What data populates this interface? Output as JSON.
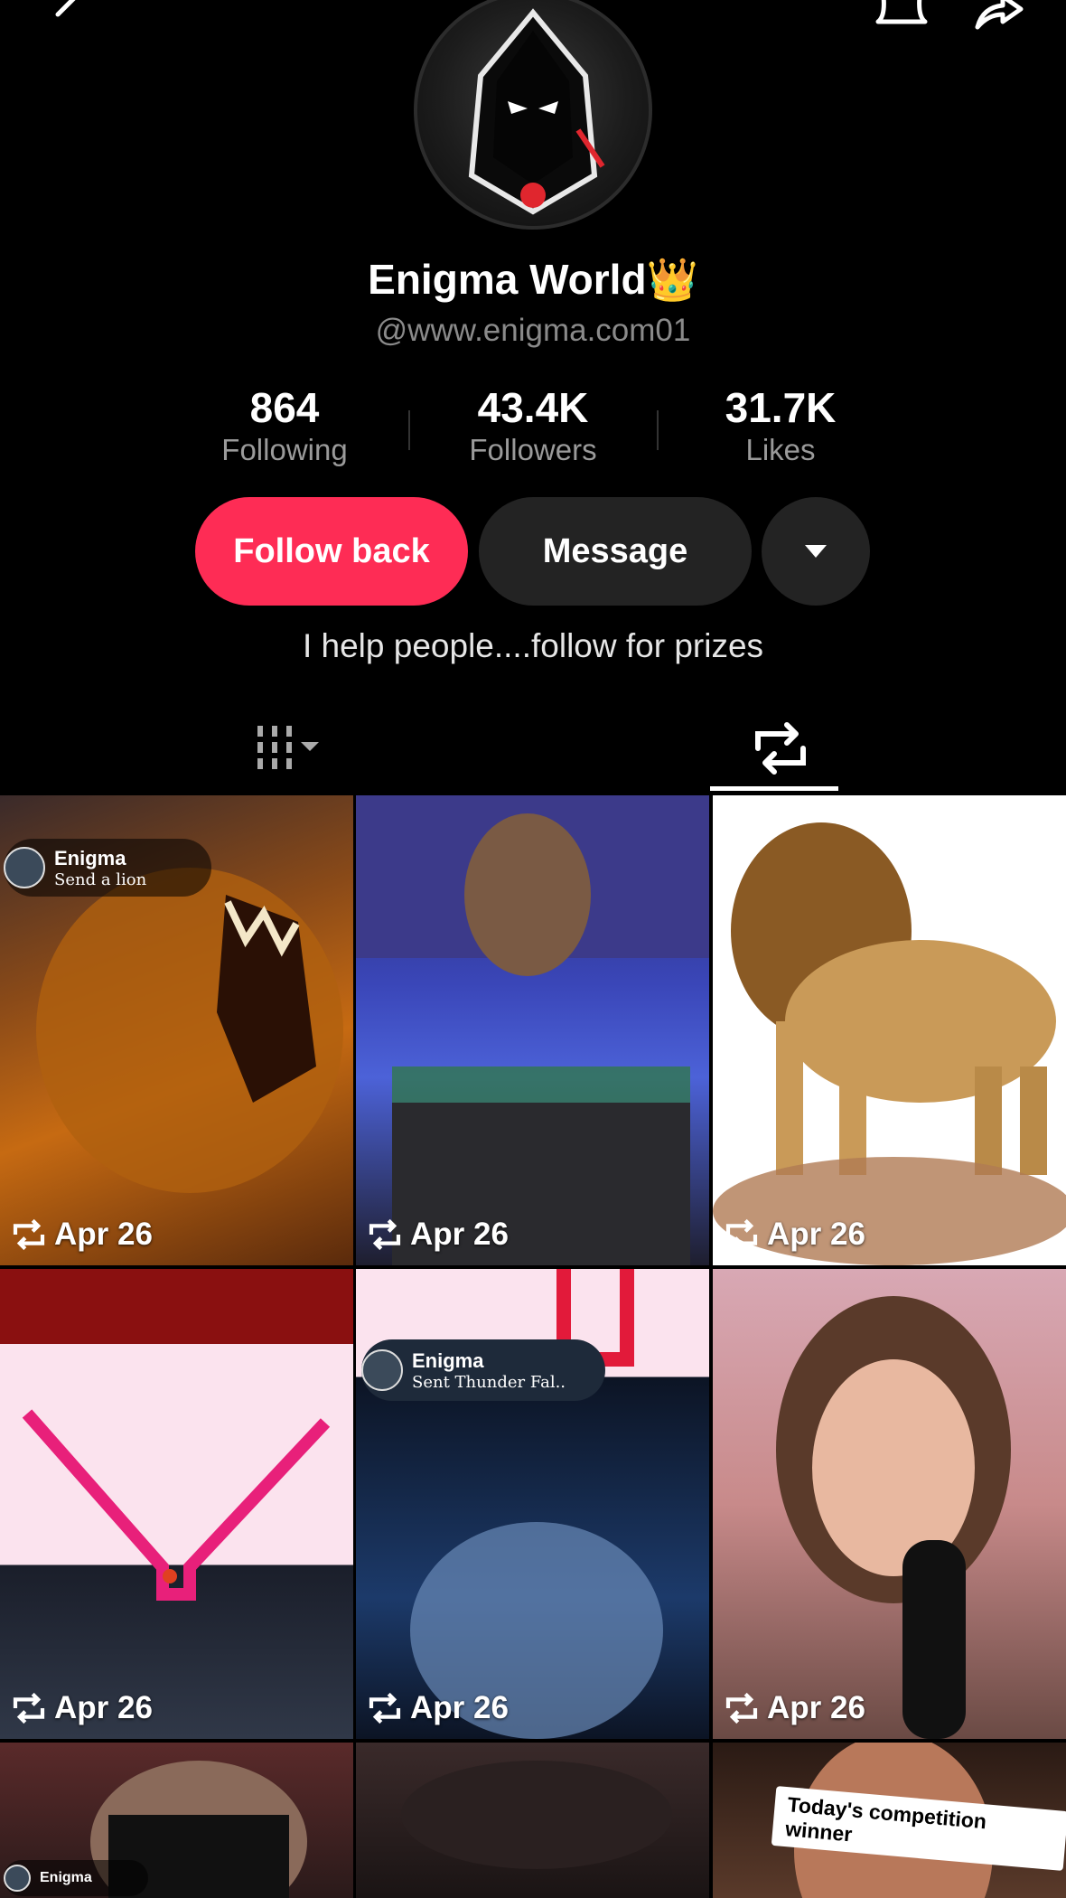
{
  "profile": {
    "name": "Enigma World👑",
    "handle": "@www.enigma.com01",
    "bio": "I help people....follow for prizes"
  },
  "stats": [
    {
      "value": "864",
      "label": "Following"
    },
    {
      "value": "43.4K",
      "label": "Followers"
    },
    {
      "value": "31.7K",
      "label": "Likes"
    }
  ],
  "buttons": {
    "follow_back": "Follow back",
    "message": "Message"
  },
  "tabs": [
    {
      "icon": "videos-grid-icon",
      "selected": false
    },
    {
      "icon": "repost-icon",
      "selected": true
    }
  ],
  "colors": {
    "accent": "#fe2c55",
    "button_dark": "#232323",
    "muted_text": "#8a8a8a"
  },
  "videos": [
    {
      "date": "Apr 26",
      "overlay_name": "Enigma",
      "overlay_sub": "Send a lion"
    },
    {
      "date": "Apr 26"
    },
    {
      "date": "Apr 26"
    },
    {
      "date": "Apr 26"
    },
    {
      "date": "Apr 26",
      "overlay_name": "Enigma",
      "overlay_sub": "Sent Thunder Fal.."
    },
    {
      "date": "Apr 26"
    },
    {
      "overlay_name": "Enigma"
    },
    {},
    {
      "caption": "Today's competition winner"
    }
  ]
}
